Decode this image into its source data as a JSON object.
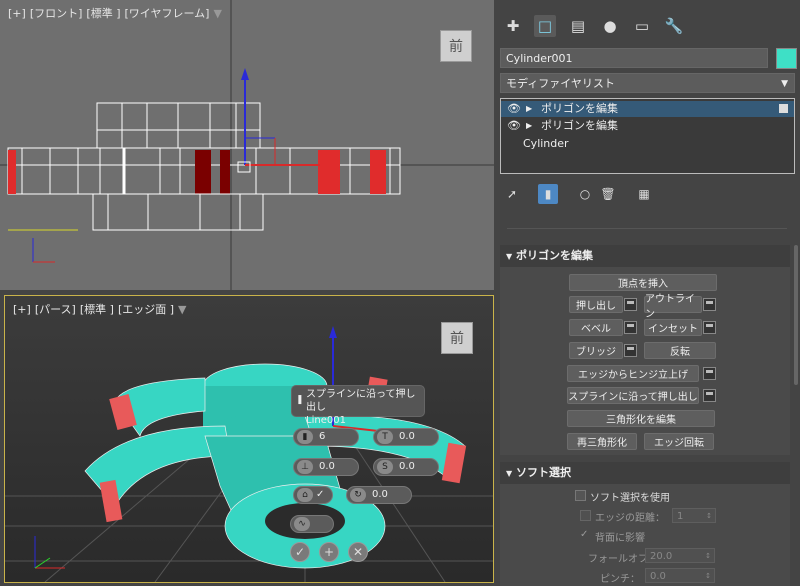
{
  "viewport_front": {
    "label_plus": "[+]",
    "label_view": "[フロント]",
    "label_shading": "[標準 ]",
    "label_mode": "[ワイヤフレーム]",
    "viewcube": "前"
  },
  "viewport_persp": {
    "label_plus": "[+]",
    "label_view": "[パース]",
    "label_shading": "[標準 ]",
    "label_mode": "[エッジ面 ]",
    "viewcube": "前"
  },
  "caddy": {
    "title_line1": "スプラインに沿って押し出し",
    "title_line2": "Line001",
    "segments": "6",
    "taper_amount": "0.0",
    "taper_curve": "0.0",
    "twist": "0.0",
    "rotation": "0.0"
  },
  "panel": {
    "tabs": [
      "create-tab",
      "modify-tab",
      "hierarchy-tab",
      "motion-tab",
      "display-tab",
      "utilities-tab"
    ],
    "object_name": "Cylinder001",
    "object_color": "#3ee0c6",
    "modifier_list": "モディファイヤリスト",
    "stack": [
      {
        "label": "ポリゴンを編集",
        "selected": true
      },
      {
        "label": "ポリゴンを編集",
        "selected": false
      },
      {
        "label": "Cylinder",
        "selected": false
      }
    ],
    "edit_poly": {
      "title": "ポリゴンを編集",
      "insert_vertex": "頂点を挿入",
      "extrude": "押し出し",
      "outline": "アウトライン",
      "bevel": "ベベル",
      "inset": "インセット",
      "bridge": "ブリッジ",
      "flip": "反転",
      "hinge": "エッジからヒンジ立上げ",
      "extrude_spline": "スプラインに沿って押し出し",
      "edit_tri": "三角形化を編集",
      "retriangulate": "再三角形化",
      "turn": "エッジ回転"
    },
    "soft_sel": {
      "title": "ソフト選択",
      "use": "ソフト選択を使用",
      "edge_distance": "エッジの距離：",
      "edge_distance_val": "1",
      "affect_backfacing": "背面に影響",
      "falloff": "フォールオフ：",
      "falloff_val": "20.0",
      "pinch": "ピンチ：",
      "pinch_val": "0.0"
    }
  }
}
